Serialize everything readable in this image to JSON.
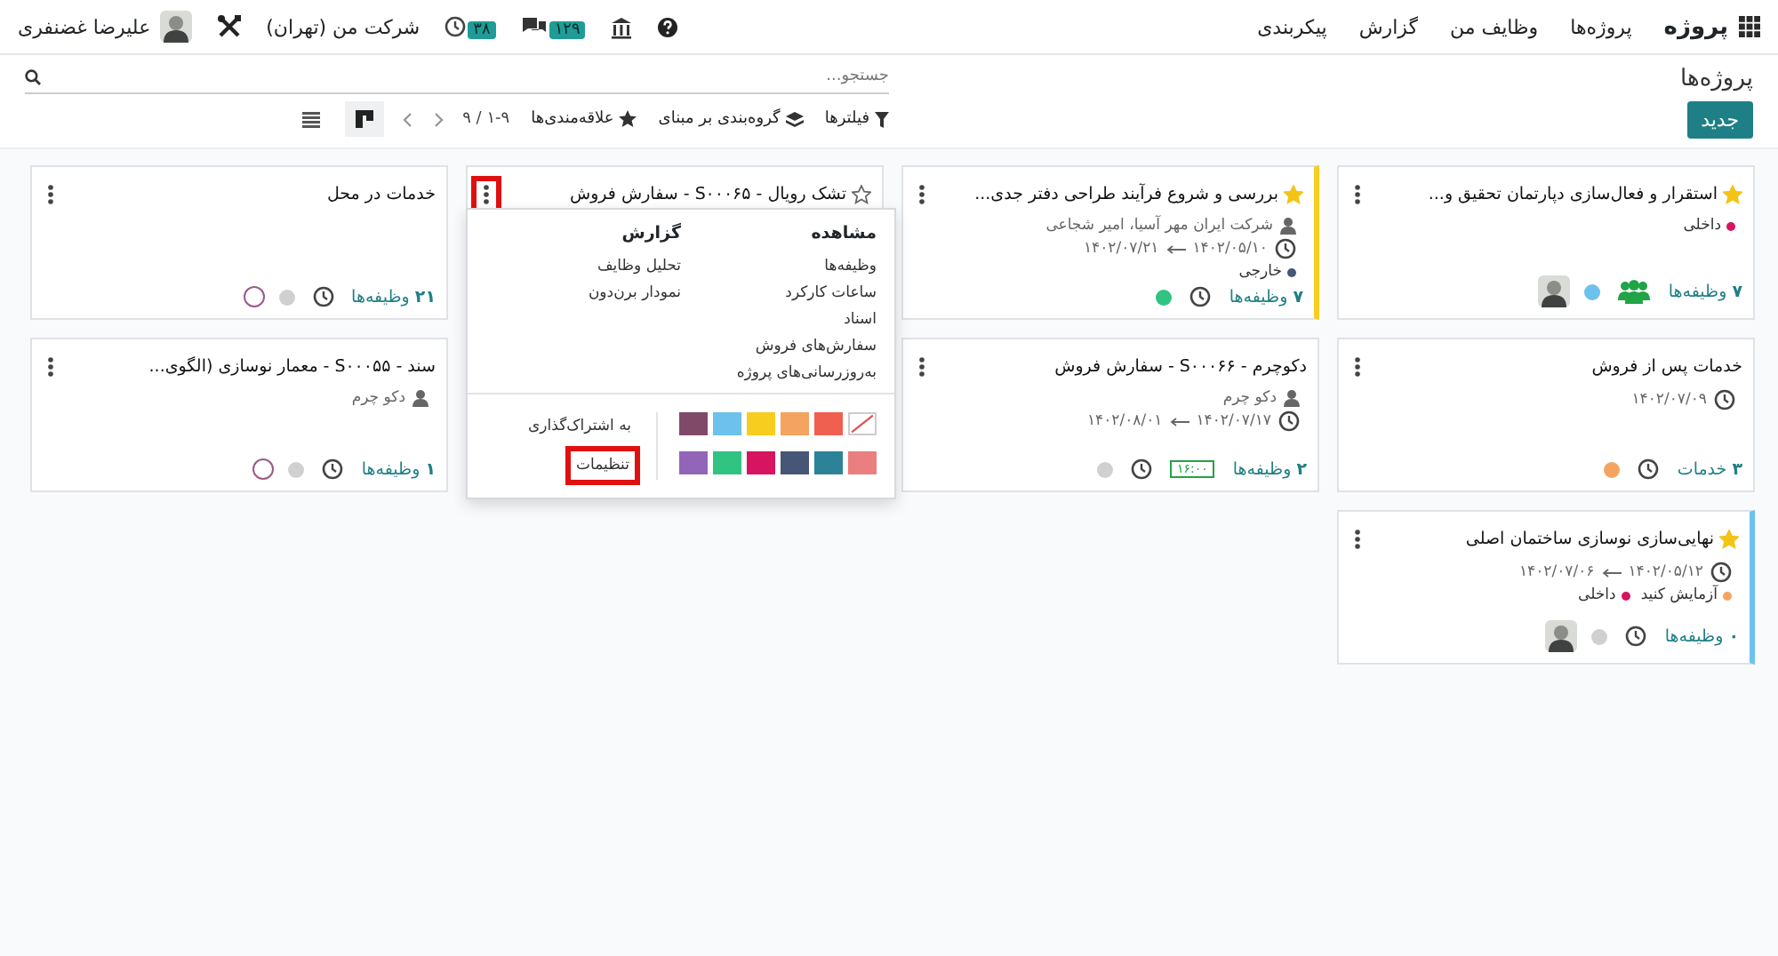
{
  "navbar": {
    "app": "پروژه",
    "menu": [
      "پروژه‌ها",
      "وظایف من",
      "گزارش",
      "پیکربندی"
    ],
    "messages_count": "۱۲۹",
    "activities_count": "۳۸",
    "company": "شرکت من (تهران)",
    "user": "علیرضا غضنفری"
  },
  "breadcrumb": "پروژه‌ها",
  "new_button": "جدید",
  "search": {
    "placeholder": "جستجو..."
  },
  "filters": [
    {
      "label": "فیلترها",
      "kind": "filter"
    },
    {
      "label": "گروه‌بندی بر مبنای",
      "kind": "group"
    },
    {
      "label": "علاقه‌مندی‌ها",
      "kind": "favorite"
    }
  ],
  "pager": "۱-۹ / ۹",
  "views": [
    {
      "kind": "kanban",
      "selected": true
    },
    {
      "kind": "list",
      "selected": false
    }
  ],
  "cards": [
    {
      "title": "استقرار و فعال‌سازی دپارتمان تحقیق و...",
      "favorite": true,
      "tags": [
        {
          "label": "داخلی",
          "color": "#d6145f"
        }
      ],
      "count_label": "**۷** وظیفه‌ها",
      "activity_icon": {
        "kind": "people"
      },
      "status": {
        "color": "#6cc1ed"
      },
      "avatar": {
        "kind": "photo"
      }
    },
    {
      "title": "بررسی و شروع فرآیند طراحی دفتر جدی...",
      "favorite": true,
      "stripe": {
        "color": "#f7cd1f"
      },
      "customer": "شرکت ایران مهر آسیا، امیر شجاعی",
      "dates": {
        "start": "۱۴۰۲/۰۵/۱۰",
        "end": "۱۴۰۲/۰۷/۲۱"
      },
      "tags": [
        {
          "label": "خارجی",
          "color": "#475577"
        }
      ],
      "count_label": "**۷** وظیفه‌ها",
      "activity_icon": {
        "kind": "clock"
      },
      "status": {
        "color": "#30c381"
      }
    },
    {
      "title": "تشک رویال - S۰۰۰۶۵ - سفارش فروش",
      "favorite": false,
      "menu": {
        "highlighted": true,
        "open": true
      }
    },
    {
      "title": "خدمات در محل",
      "count_label": "**۲۱** وظیفه‌ها",
      "activity_icon": {
        "kind": "clock"
      },
      "status": {
        "color": "#d0d0d0"
      },
      "avatar": {
        "kind": "empty"
      }
    },
    {
      "title": "خدمات پس از فروش",
      "dates": {
        "start": "۱۴۰۲/۰۷/۰۹"
      },
      "count_label": "**۳** خدمات",
      "activity_icon": {
        "kind": "clock"
      },
      "status": {
        "color": "#f4a460"
      }
    },
    {
      "title": "دکوچرم - S۰۰۰۶۶ - سفارش فروش",
      "customer": "دکو چرم",
      "dates": {
        "start": "۱۴۰۲/۰۷/۱۷",
        "end": "۱۴۰۲/۰۸/۰۱"
      },
      "count_label": "**۲** وظیفه‌ها",
      "timesheet": "۱۶:۰۰",
      "activity_icon": {
        "kind": "clock"
      },
      "status": {
        "color": "#d0d0d0"
      }
    },
    {
      "title": "سند - S۰۰۰۵۵ - معمار نوسازی (الگوی...",
      "customer": "دکو چرم",
      "count_label": "**۱** وظیفه‌ها",
      "activity_icon": {
        "kind": "clock"
      },
      "status": {
        "color": "#d0d0d0"
      },
      "avatar": {
        "kind": "empty"
      }
    },
    {
      "title": "نهایی‌سازی نوسازی ساختمان اصلی",
      "favorite": true,
      "stripe": {
        "color": "#6cc1ed"
      },
      "dates": {
        "start": "۱۴۰۲/۰۵/۱۲",
        "end": "۱۴۰۲/۰۷/۰۶"
      },
      "tags": [
        {
          "label": "آزمایش کنید",
          "color": "#f4a460"
        },
        {
          "label": "داخلی",
          "color": "#d6145f"
        }
      ],
      "count_label": "**۰** وظیفه‌ها",
      "activity_icon": {
        "kind": "clock"
      },
      "status": {
        "color": "#d0d0d0"
      },
      "avatar": {
        "kind": "photo"
      }
    }
  ],
  "dropdown": {
    "sections": [
      {
        "heading": "مشاهده",
        "items": [
          "وظیفه‌ها",
          "ساعات کارکرد",
          "اسناد",
          "سفارش‌های فروش",
          "به‌روزرسانی‌های پروژه"
        ]
      },
      {
        "heading": "گزارش",
        "items": [
          "تحلیل وظایف",
          "نمودار برن‌دون"
        ]
      }
    ],
    "colors": [
      {
        "kind": "none"
      },
      {
        "kind": "color",
        "color": "#f06050"
      },
      {
        "kind": "color",
        "color": "#f4a460"
      },
      {
        "kind": "color",
        "color": "#f7cd1f"
      },
      {
        "kind": "color",
        "color": "#6cc1ed"
      },
      {
        "kind": "color",
        "color": "#814968"
      },
      {
        "kind": "color",
        "color": "#eb7e7f"
      },
      {
        "kind": "color",
        "color": "#2c8397"
      },
      {
        "kind": "color",
        "color": "#475577"
      },
      {
        "kind": "color",
        "color": "#d6145f"
      },
      {
        "kind": "color",
        "color": "#30c381"
      },
      {
        "kind": "color",
        "color": "#9365b8"
      }
    ],
    "actions": [
      {
        "label": "به اشتراک‌گذاری",
        "highlighted": false
      },
      {
        "label": "تنظیمات",
        "highlighted": true
      }
    ]
  }
}
